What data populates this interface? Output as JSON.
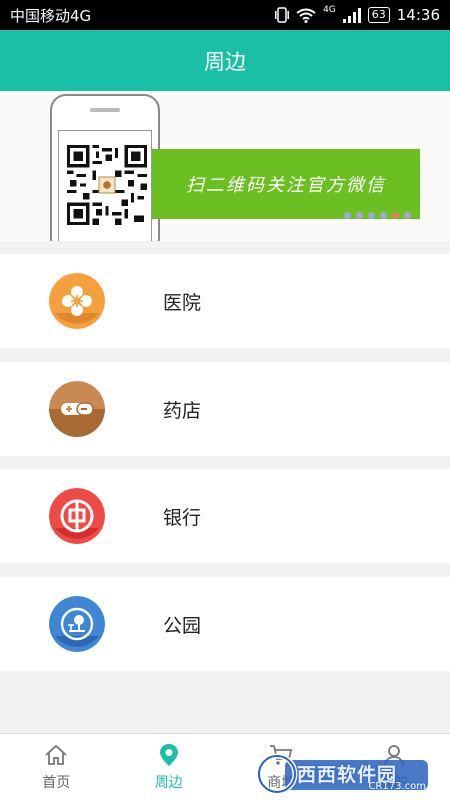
{
  "status_bar": {
    "carrier": "中国移动4G",
    "battery": "63",
    "time": "14:36",
    "network": "4G"
  },
  "header": {
    "title": "周边"
  },
  "banner": {
    "slogan": "扫二维码关注官方微信",
    "dot_count": 6,
    "active_dot": 4
  },
  "categories": [
    {
      "label": "医院",
      "icon": "hospital-icon",
      "color": "#f5a03c",
      "shade": "#e2862a"
    },
    {
      "label": "药店",
      "icon": "pill-icon",
      "color": "#c88a52",
      "shade": "#a86a32"
    },
    {
      "label": "银行",
      "icon": "bank-icon",
      "color": "#ef4b45",
      "shade": "#d3302d"
    },
    {
      "label": "公园",
      "icon": "park-icon",
      "color": "#3f87d4",
      "shade": "#2a6ab5"
    }
  ],
  "bottom_nav": [
    {
      "label": "首页",
      "icon": "home-icon",
      "active": false
    },
    {
      "label": "周边",
      "icon": "location-pin-icon",
      "active": true
    },
    {
      "label": "商城",
      "icon": "cart-icon",
      "active": false
    },
    {
      "label": "我的",
      "icon": "user-icon",
      "active": false
    }
  ],
  "watermark": {
    "text": "西西软件园",
    "sub": "CR173.com"
  },
  "colors": {
    "accent": "#1bbfa6",
    "banner_green": "#6bbf22"
  }
}
